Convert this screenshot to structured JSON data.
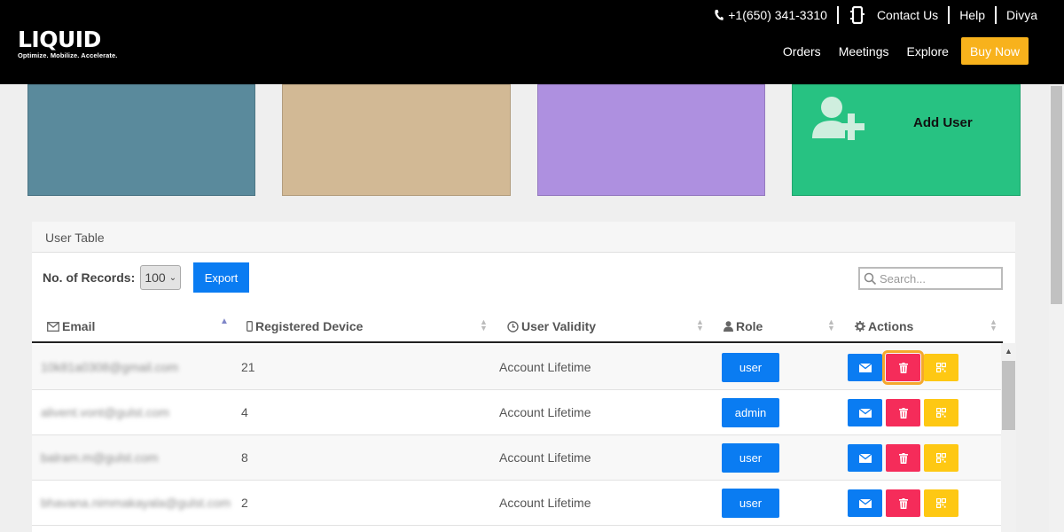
{
  "header": {
    "logo_text": "LIQUID",
    "logo_tagline": "Optimize. Mobilize. Accelerate.",
    "phone": "+1(650) 341-3310",
    "contact_label": "Contact Us",
    "help_label": "Help",
    "user_name": "Divya",
    "nav": [
      "Orders",
      "Meetings",
      "Explore"
    ],
    "buy_now": "Buy Now",
    "accent_color": "#f8b21c"
  },
  "cards": {
    "add_user_label": "Add User",
    "colors": [
      "#5a8a9c",
      "#d2b995",
      "#ae90e0",
      "#27c282"
    ]
  },
  "table": {
    "panel_title": "User Table",
    "records_label": "No. of Records:",
    "records_value": "100",
    "export_label": "Export",
    "search_placeholder": "Search...",
    "columns": [
      "Email",
      "Registered Device",
      "User Validity",
      "Role",
      "Actions"
    ],
    "rows": [
      {
        "email": "10k81a0308@gmail.com",
        "devices": "21",
        "validity": "Account Lifetime",
        "role": "user"
      },
      {
        "email": "alivent.vont@gulst.com",
        "devices": "4",
        "validity": "Account Lifetime",
        "role": "admin"
      },
      {
        "email": "balram.m@gulst.com",
        "devices": "8",
        "validity": "Account Lifetime",
        "role": "user"
      },
      {
        "email": "bhavana.nimmakayala@gulst.com",
        "devices": "2",
        "validity": "Account Lifetime",
        "role": "user"
      }
    ],
    "action_icons": [
      "envelope-icon",
      "trash-icon",
      "qr-code-icon"
    ]
  }
}
